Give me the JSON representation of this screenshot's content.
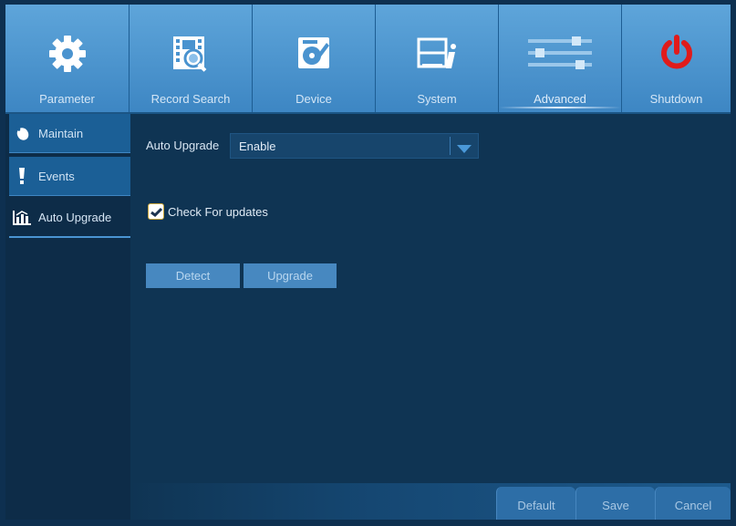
{
  "topnav": {
    "tabs": [
      {
        "label": "Parameter",
        "icon": "gear-icon"
      },
      {
        "label": "Record Search",
        "icon": "film-search-icon"
      },
      {
        "label": "Device",
        "icon": "disk-edit-icon"
      },
      {
        "label": "System",
        "icon": "system-info-icon"
      },
      {
        "label": "Advanced",
        "icon": "sliders-icon",
        "active": true
      },
      {
        "label": "Shutdown",
        "icon": "power-icon"
      }
    ]
  },
  "sidebar": {
    "items": [
      {
        "label": "Maintain",
        "icon": "maintain-icon"
      },
      {
        "label": "Events",
        "icon": "exclamation-icon"
      },
      {
        "label": "Auto Upgrade",
        "icon": "bar-chart-icon",
        "active": true
      }
    ]
  },
  "content": {
    "auto_upgrade_label": "Auto Upgrade",
    "auto_upgrade_value": "Enable",
    "check_updates_label": "Check For updates",
    "check_updates_checked": true,
    "detect_button": "Detect",
    "upgrade_button": "Upgrade"
  },
  "footer": {
    "default_button": "Default",
    "save_button": "Save",
    "cancel_button": "Cancel"
  },
  "colors": {
    "nav_gradient_top": "#5ea5da",
    "nav_gradient_bottom": "#3d86c3",
    "panel_background": "#0f3453",
    "power_icon": "#e01b1b",
    "button_fill": "#4788c0"
  }
}
